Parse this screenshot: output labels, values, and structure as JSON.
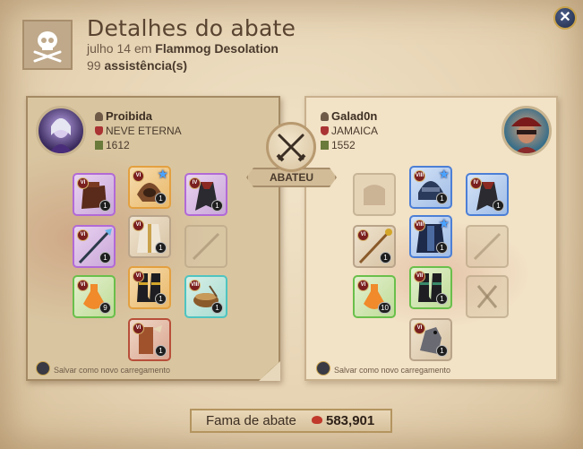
{
  "header": {
    "title": "Detalhes do abate",
    "date": "julho 14",
    "location_prefix": "em",
    "location": "Flammog Desolation",
    "assist_count": "99",
    "assist_label": "assistência(s)",
    "close_symbol": "✕"
  },
  "killer": {
    "name": "Proibida",
    "guild": "NEVE ETERNA",
    "item_power": "1612",
    "save_label": "Salvar como novo carregamento",
    "slots": [
      {
        "name": "bag",
        "tier": "VI",
        "qty": "1",
        "rarity": "purple",
        "icon": "bag-icon"
      },
      {
        "name": "helmet",
        "tier": "VI",
        "qty": "1",
        "rarity": "orange",
        "icon": "hood-icon",
        "star": true
      },
      {
        "name": "cape",
        "tier": "IV",
        "qty": "1",
        "rarity": "purple",
        "icon": "cape-icon"
      },
      {
        "name": "main-hand",
        "tier": "VI",
        "qty": "1",
        "rarity": "purple",
        "icon": "spear-icon"
      },
      {
        "name": "armor",
        "tier": "VI",
        "qty": "1",
        "rarity": "plain",
        "icon": "robe-icon"
      },
      {
        "name": "off-hand",
        "tier": "",
        "qty": "",
        "rarity": "empty",
        "icon": "empty-slot-icon"
      },
      {
        "name": "potion",
        "tier": "VI",
        "qty": "9",
        "rarity": "green",
        "icon": "potion-icon"
      },
      {
        "name": "boots",
        "tier": "VI",
        "qty": "1",
        "rarity": "orange",
        "icon": "boots-icon"
      },
      {
        "name": "food",
        "tier": "VIII",
        "qty": "1",
        "rarity": "teal",
        "icon": "bowl-icon"
      },
      {
        "name": "mount",
        "tier": "VI",
        "qty": "1",
        "rarity": "red",
        "icon": "ox-icon"
      }
    ]
  },
  "victim": {
    "name": "Galad0n",
    "guild": "JAMAICA",
    "item_power": "1552",
    "save_label": "Salvar como novo carregamento",
    "slots": [
      {
        "name": "bag",
        "tier": "",
        "qty": "",
        "rarity": "empty",
        "icon": "bag-icon"
      },
      {
        "name": "helmet",
        "tier": "VIII",
        "qty": "1",
        "rarity": "blue",
        "icon": "helmet-icon",
        "star": true
      },
      {
        "name": "cape",
        "tier": "IV",
        "qty": "1",
        "rarity": "blue",
        "icon": "cape-icon"
      },
      {
        "name": "main-hand",
        "tier": "VI",
        "qty": "1",
        "rarity": "plain",
        "icon": "staff-icon"
      },
      {
        "name": "armor",
        "tier": "VIII",
        "qty": "1",
        "rarity": "blue",
        "icon": "armor-icon",
        "star": true
      },
      {
        "name": "off-hand",
        "tier": "",
        "qty": "",
        "rarity": "empty",
        "icon": "empty-slot-icon"
      },
      {
        "name": "potion",
        "tier": "VI",
        "qty": "10",
        "rarity": "green",
        "icon": "potion-icon"
      },
      {
        "name": "boots",
        "tier": "VII",
        "qty": "1",
        "rarity": "green",
        "icon": "boots-icon"
      },
      {
        "name": "food",
        "tier": "",
        "qty": "",
        "rarity": "empty",
        "icon": "fork-knife-icon"
      },
      {
        "name": "mount",
        "tier": "VI",
        "qty": "1",
        "rarity": "plain",
        "icon": "horse-icon"
      }
    ]
  },
  "center": {
    "kill_label": "ABATEU",
    "icon": "crossed-swords-icon"
  },
  "fame": {
    "label": "Fama de abate",
    "value": "583,901",
    "icon": "gem-icon"
  },
  "colors": {
    "parchment": "#ead9bd",
    "title": "#5a4431",
    "fame_gem": "#c0392b"
  }
}
